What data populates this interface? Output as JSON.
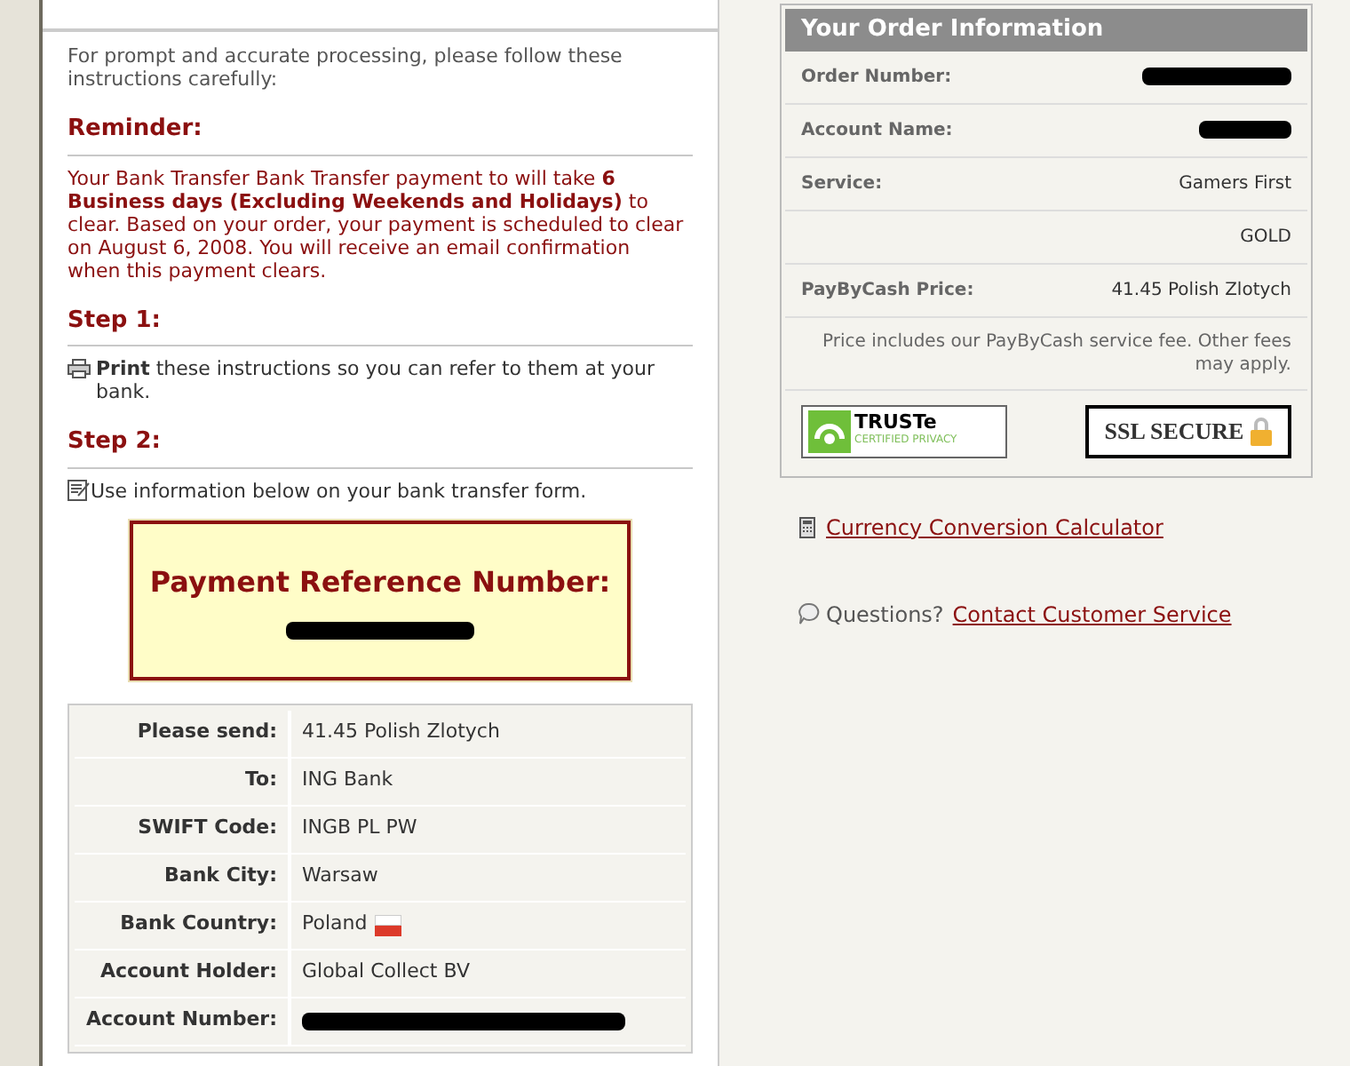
{
  "intro": "For prompt and accurate processing, please follow these instructions carefully:",
  "reminder": {
    "heading": "Reminder:",
    "text": "Your Bank Transfer Bank Transfer payment to will take **6 Business days (Excluding Weekends and Holidays)** to clear. Based on your order, your payment is scheduled to clear on August 6, 2008. You will receive an email confirmation when this payment clears."
  },
  "step1": {
    "heading": "Step 1:",
    "text": "**Print** these instructions so you can refer to them at your bank."
  },
  "step2": {
    "heading": "Step 2:",
    "text": "Use information below on your bank transfer form."
  },
  "reference": {
    "title": "Payment Reference Number:",
    "redacted": true
  },
  "transfer_rows": [
    {
      "label": "Please send:",
      "value": "41.45 Polish Zlotych",
      "redacted": false,
      "flag": false
    },
    {
      "label": "To:",
      "value": "ING Bank",
      "redacted": false,
      "flag": false
    },
    {
      "label": "SWIFT Code:",
      "value": "INGB PL PW",
      "redacted": false,
      "flag": false
    },
    {
      "label": "Bank City:",
      "value": "Warsaw",
      "redacted": false,
      "flag": false
    },
    {
      "label": "Bank Country:",
      "value": "Poland",
      "redacted": false,
      "flag": true
    },
    {
      "label": "Account Holder:",
      "value": "Global Collect BV",
      "redacted": false,
      "flag": false
    },
    {
      "label": "Account Number:",
      "redacted": true,
      "flag": false
    }
  ],
  "order": {
    "title": "Your Order Information",
    "rows": [
      {
        "label": "Order Number:",
        "redacted": true
      },
      {
        "label": "Account Name:",
        "redacted": true
      },
      {
        "label": "Service:",
        "value": "Gamers First",
        "redacted": false
      },
      {
        "value": "GOLD",
        "redacted": false
      },
      {
        "label": "PayByCash Price:",
        "value": "41.45 Polish Zlotych",
        "redacted": false
      }
    ],
    "note": "Price includes our PayByCash service fee. Other fees may apply.",
    "badges": {
      "truste": "TRUSTe",
      "truste_sub": "CERTIFIED PRIVACY",
      "ssl": "SSL SECURE"
    }
  },
  "links": {
    "calculator": "Currency Conversion Calculator",
    "questions": "Questions?",
    "contact": "Contact Customer Service"
  }
}
